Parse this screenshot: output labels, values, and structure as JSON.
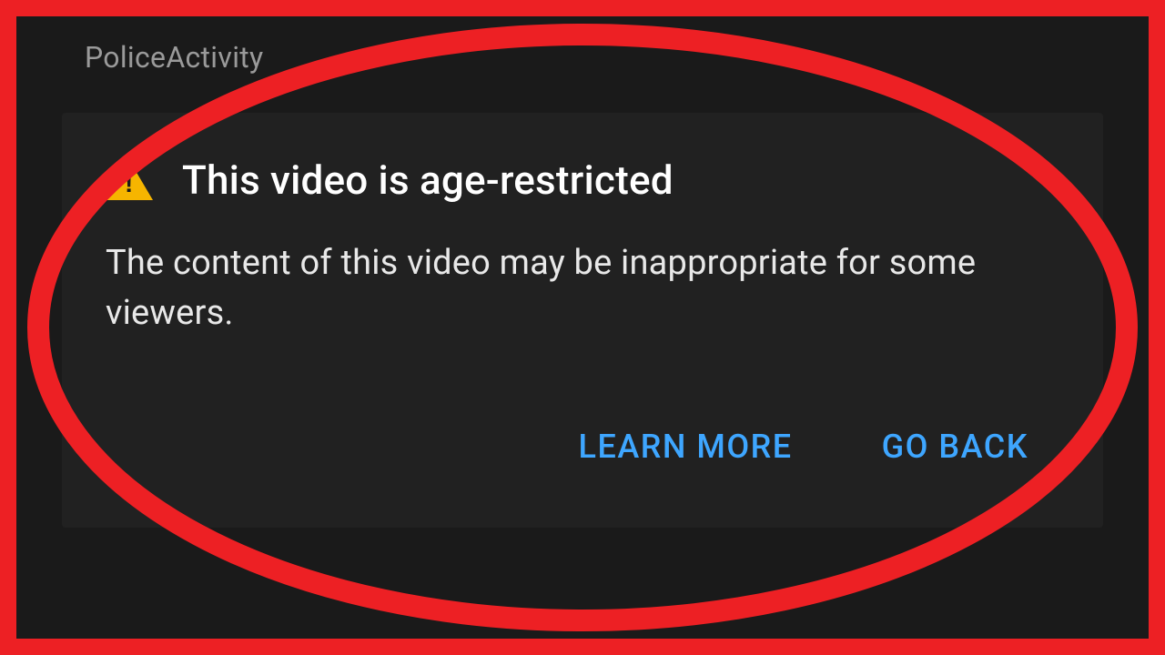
{
  "channel": {
    "name": "PoliceActivity"
  },
  "warning": {
    "title": "This video is age-restricted",
    "description": "The content of this video may be inappropriate for some viewers.",
    "learn_more_label": "LEARN MORE",
    "go_back_label": "GO BACK"
  },
  "colors": {
    "frame_red": "#ed2024",
    "accent_blue": "#3ea6ff",
    "warning_yellow": "#f6b500"
  }
}
